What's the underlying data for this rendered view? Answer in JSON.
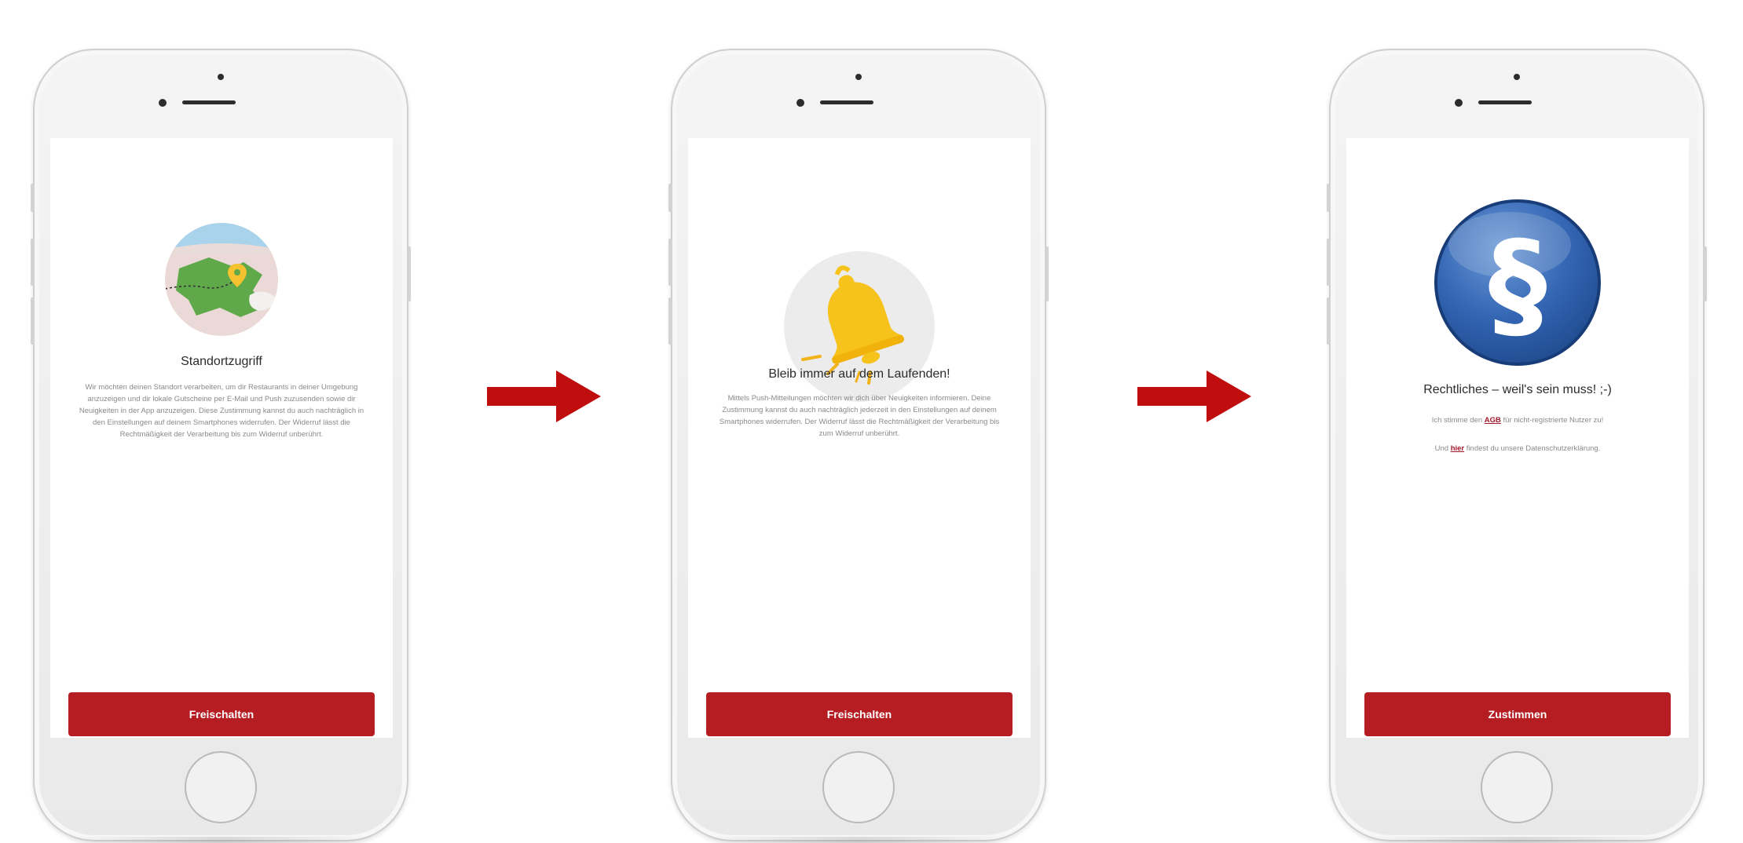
{
  "screens": [
    {
      "title": "Standortzugriff",
      "body": "Wir möchten deinen Standort verarbeiten, um dir Restaurants in deiner Umgebung anzuzeigen und dir lokale Gutscheine per E-Mail und Push zuzusenden sowie dir Neuigkeiten in der App anzuzeigen. Diese Zustimmung kannst du auch nachträglich in den Einstellungen auf deinem Smartphones widerrufen. Der Widerruf lässt die Rechtmäßigkeit der Verarbeitung bis zum Widerruf unberührt.",
      "button_label": "Freischalten",
      "icon": "map-location-icon",
      "active_dot": 0
    },
    {
      "title": "Bleib immer auf dem Laufenden!",
      "body": "Mittels Push-Mitteilungen möchten wir dich über Neuigkeiten informieren. Deine Zustimmung kannst du auch nachträglich jederzeit in den Einstellungen auf deinem Smartphones widerrufen. Der Widerruf lässt die Rechtmäßigkeit der Verarbeitung bis zum Widerruf unberührt.",
      "button_label": "Freischalten",
      "icon": "bell-icon",
      "active_dot": 1
    },
    {
      "title": "Rechtliches – weil's sein muss! ;-)",
      "line1_prefix": "Ich stimme den",
      "line1_link": "AGB",
      "line1_suffix": "für nicht-registrierte Nutzer zu!",
      "line2_prefix": "Und",
      "line2_link": "hier",
      "line2_suffix": "findest du unsere Datenschutzerklärung.",
      "button_label": "Zustimmen",
      "icon": "paragraph-icon",
      "active_dot": 2
    }
  ],
  "colors": {
    "accent": "#b51d23",
    "arrow": "#c00d0d",
    "link": "#a3172a"
  }
}
